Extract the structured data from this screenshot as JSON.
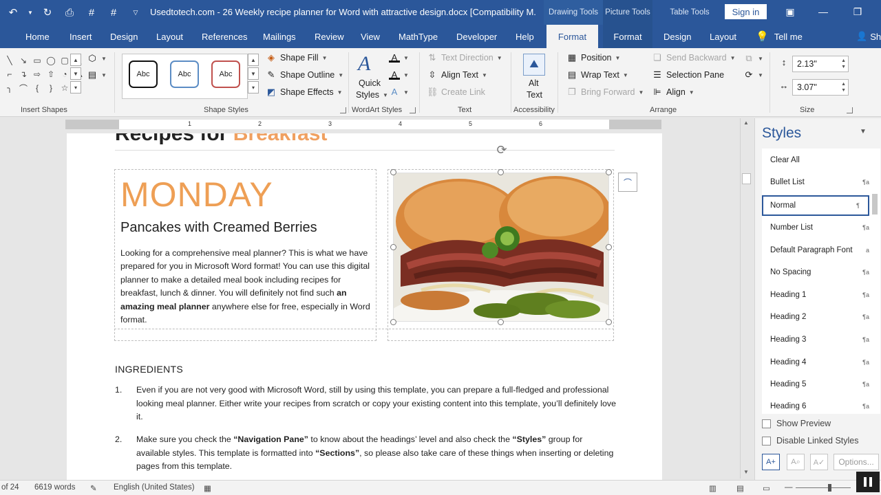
{
  "window": {
    "title": "Usedtotech.com - 26 Weekly recipe planner for Word with attractive design.docx [Compatibility M...",
    "context_tabs": [
      "Drawing Tools",
      "Picture Tools",
      "Table Tools"
    ],
    "sign_in": "Sign in"
  },
  "tabs": [
    "Home",
    "Insert",
    "Design",
    "Layout",
    "References",
    "Mailings",
    "Review",
    "View",
    "MathType",
    "Developer",
    "Help",
    "Format",
    "Format",
    "Design",
    "Layout"
  ],
  "tell_me": "Tell me",
  "share_short": "Sh",
  "ribbon": {
    "insert_shapes_label": "Insert Shapes",
    "shape_styles_label": "Shape Styles",
    "abc_label": "Abc",
    "shape_fill": "Shape Fill",
    "shape_outline": "Shape Outline",
    "shape_effects": "Shape Effects",
    "quick_styles_1": "Quick",
    "quick_styles_2": "Styles",
    "wordart_label": "WordArt Styles",
    "text_direction": "Text Direction",
    "align_text": "Align Text",
    "create_link": "Create Link",
    "text_label": "Text",
    "alt_text_1": "Alt",
    "alt_text_2": "Text",
    "accessibility_label": "Accessibility",
    "position": "Position",
    "wrap_text": "Wrap Text",
    "bring_forward": "Bring Forward",
    "send_backward": "Send Backward",
    "selection_pane": "Selection Pane",
    "align": "Align",
    "arrange_label": "Arrange",
    "height": "2.13\"",
    "width": "3.07\"",
    "size_label": "Size"
  },
  "ruler_numbers": [
    "1",
    "2",
    "3",
    "4",
    "5",
    "6"
  ],
  "document": {
    "heading_part1": "Recipes for ",
    "heading_part2": "Breakfast",
    "day": "MONDAY",
    "recipe_title": "Pancakes with Creamed Berries",
    "intro_1": "Looking for a comprehensive meal planner? This is what we have prepared for you in Microsoft Word format! You can use this digital planner to make a detailed meal book including recipes for breakfast, lunch & dinner. You will definitely not find such ",
    "intro_bold": "an amazing meal planner",
    "intro_2": " anywhere else for free, especially in Word format.",
    "ingredients_heading": "INGREDIENTS",
    "item1_num": "1.",
    "item1_text": "Even if you are not very good with Microsoft Word, still by using this template, you can prepare a full-fledged and professional looking meal planner. Either write your recipes from scratch or copy your existing content into this template, you’ll definitely love it.",
    "item2_num": "2.",
    "item2_a": "Make sure you check the ",
    "item2_b": "“Navigation Pane”",
    "item2_c": " to know about the headings’ level and also check the ",
    "item2_d": "“Styles”",
    "item2_e": " group for available styles. This template is formatted into ",
    "item2_f": "“Sections”",
    "item2_g": ", so please also take care of these things when inserting or deleting pages from this template."
  },
  "styles_pane": {
    "title": "Styles",
    "items": [
      "Clear All",
      "Bullet List",
      "Normal",
      "Number List",
      "Default Paragraph Font",
      "No Spacing",
      "Heading 1",
      "Heading 2",
      "Heading 3",
      "Heading 4",
      "Heading 5",
      "Heading 6"
    ],
    "show_preview": "Show Preview",
    "disable_linked": "Disable Linked Styles",
    "options": "Options..."
  },
  "status": {
    "page": "of 24",
    "words": "6619 words",
    "language": "English (United States)"
  },
  "colors": {
    "brand": "#2b579a",
    "accent_orange": "#ee9f55"
  }
}
